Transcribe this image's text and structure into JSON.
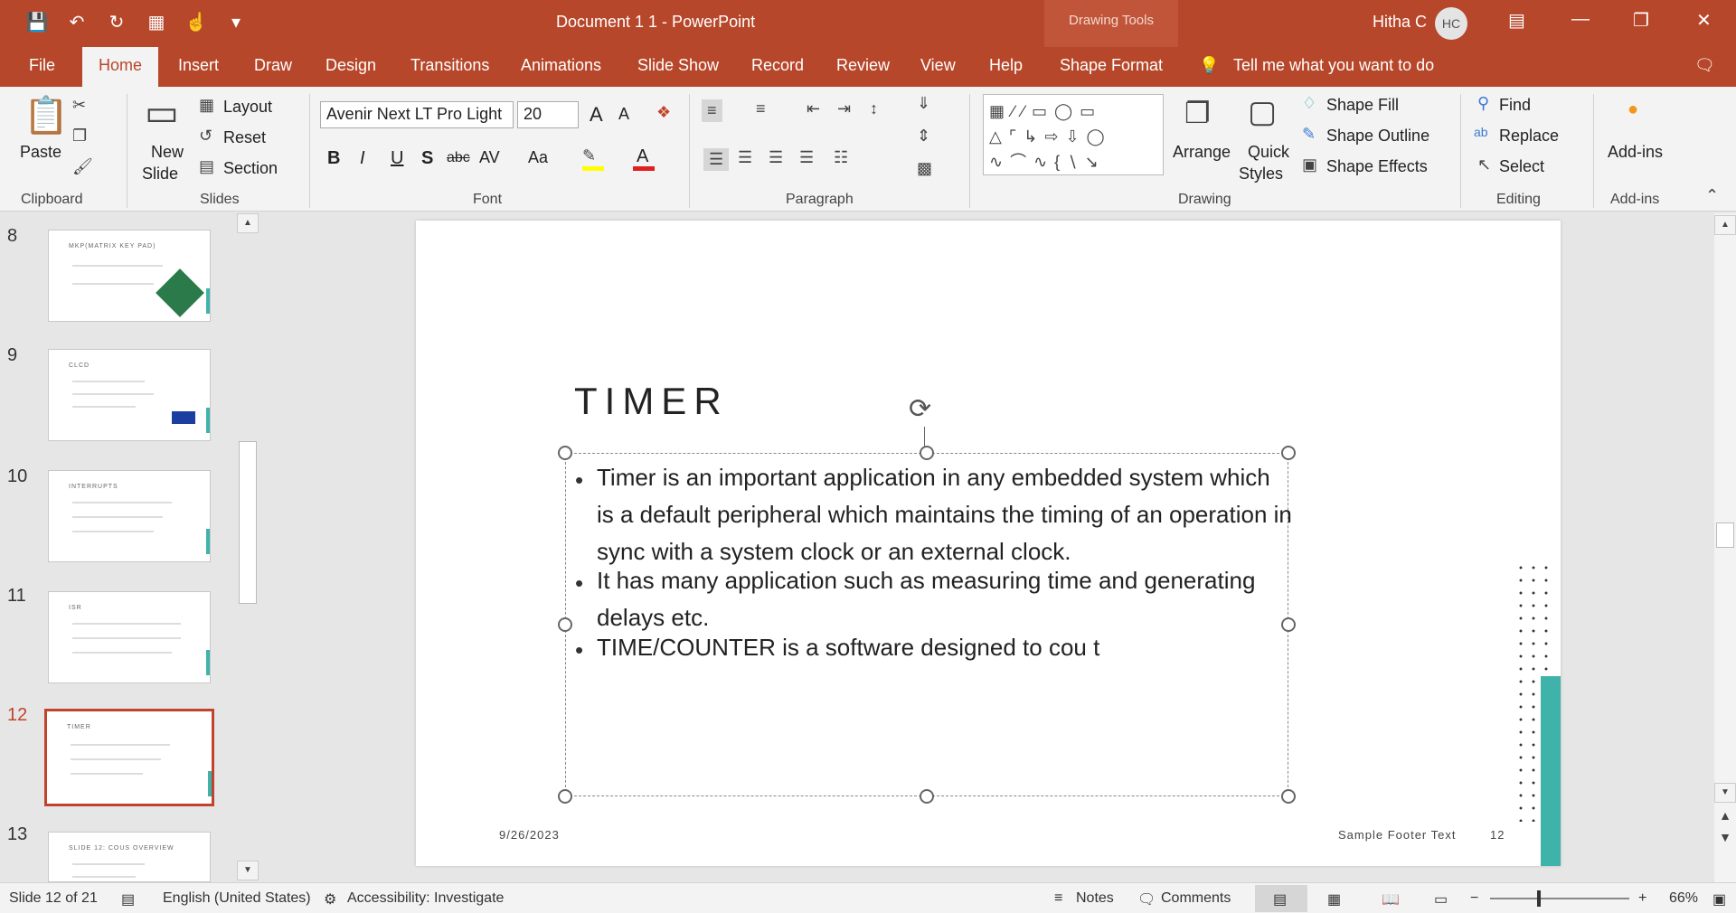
{
  "app": {
    "document_title": "Document 1 1  -  PowerPoint",
    "context_tab_group": "Drawing Tools",
    "user_name": "Hitha C",
    "user_initials": "HC"
  },
  "tabs": [
    "File",
    "Home",
    "Insert",
    "Draw",
    "Design",
    "Transitions",
    "Animations",
    "Slide Show",
    "Record",
    "Review",
    "View",
    "Help",
    "Shape Format"
  ],
  "tell_me": "Tell me what you want to do",
  "ribbon": {
    "clipboard": {
      "label": "Clipboard",
      "paste": "Paste"
    },
    "slides": {
      "label": "Slides",
      "new_slide_1": "New",
      "new_slide_2": "Slide",
      "layout": "Layout",
      "reset": "Reset",
      "section": "Section"
    },
    "font": {
      "label": "Font",
      "font_name": "Avenir Next LT Pro Light",
      "font_size": "20",
      "grow": "A",
      "shrink": "A",
      "bold": "B",
      "italic": "I",
      "underline": "U",
      "shadow": "S",
      "strike": "abc",
      "spacing": "AV",
      "case": "Aa",
      "font_color": "A"
    },
    "paragraph": {
      "label": "Paragraph"
    },
    "drawing": {
      "label": "Drawing",
      "arrange": "Arrange",
      "quick_styles_1": "Quick",
      "quick_styles_2": "Styles",
      "shape_fill": "Shape Fill",
      "shape_outline": "Shape Outline",
      "shape_effects": "Shape Effects"
    },
    "editing": {
      "label": "Editing",
      "find": "Find",
      "replace": "Replace",
      "select": "Select"
    },
    "addins": {
      "label": "Add-ins",
      "button": "Add-ins"
    }
  },
  "thumbnails": [
    {
      "number": "8",
      "title": "MKP(MATRIX KEY PAD)"
    },
    {
      "number": "9",
      "title": "CLCD"
    },
    {
      "number": "10",
      "title": "INTERRUPTS"
    },
    {
      "number": "11",
      "title": "ISR"
    },
    {
      "number": "12",
      "title": "TIMER"
    },
    {
      "number": "13",
      "title": "SLIDE 12: COUS OVERVIEW"
    }
  ],
  "slide": {
    "title": "TIMER",
    "bullets": [
      "Timer is an important application in any embedded system which is a default peripheral which maintains the timing of an operation in sync with a system clock or an external clock.",
      "It has many application such as measuring time and generating delays etc.",
      "TIME/COUNTER is a software designed to cou t"
    ],
    "footer_date": "9/26/2023",
    "footer_text": "Sample Footer Text",
    "footer_page": "12"
  },
  "status": {
    "slide_of": "Slide 12 of 21",
    "language": "English (United States)",
    "accessibility": "Accessibility: Investigate",
    "notes": "Notes",
    "comments": "Comments",
    "zoom": "66%",
    "zoom_minus": "−",
    "zoom_plus": "+"
  },
  "colors": {
    "accent": "#b7472a",
    "teal": "#3fb2a9"
  }
}
